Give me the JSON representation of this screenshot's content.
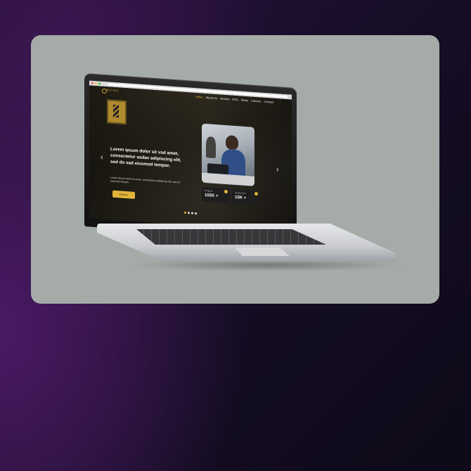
{
  "site": {
    "logo_text": "NUTIKA",
    "nav": [
      "Home",
      "About Us",
      "Sectors",
      "ESG",
      "News",
      "Careers",
      "Contact"
    ],
    "hero_title": "Lorem ipsum dolor sit vsd amet, consectetur asdav adipiscing elit, sed do sad eiusmod tempor.",
    "hero_subtitle": "Lorem ipsum dolor sit amet, consectetur adipiscing elit, sed do eiusmod tempor.",
    "explore_label": "Explore",
    "stats": [
      {
        "label": "Projects",
        "value": "102K +"
      },
      {
        "label": "Customers",
        "value": "15K +"
      }
    ],
    "arrow_left": "‹",
    "arrow_right": "›"
  },
  "colors": {
    "accent": "#e2b437",
    "card_bg": "#a5aba7"
  },
  "icons": [
    "prev-arrow-icon",
    "next-arrow-icon",
    "stat-badge-icon"
  ]
}
